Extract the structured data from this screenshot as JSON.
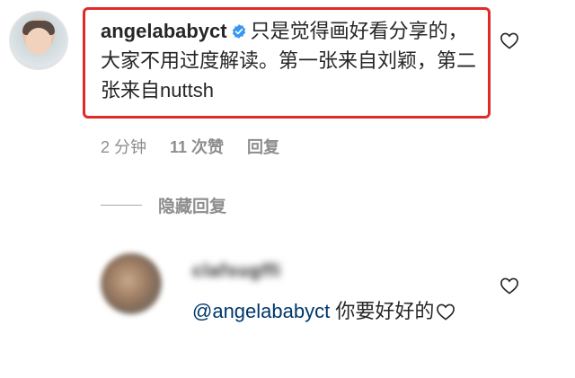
{
  "comment": {
    "username": "angelababyct",
    "text": "只是觉得画好看分享的，大家不用过度解读。第一张来自刘颖，第二张来自nuttsh",
    "time": "2 分钟",
    "likes": "11 次赞",
    "reply_label": "回复"
  },
  "hide_replies_label": "隐藏回复",
  "reply": {
    "username": "clafsugffi",
    "mention": "@angelababyct",
    "text": " 你要好好的"
  },
  "colors": {
    "highlight": "#e02a2a",
    "verified": "#3897f0",
    "mention": "#00376b",
    "muted": "#8e8e8e"
  },
  "icons": [
    "verified-badge-icon",
    "heart-icon"
  ]
}
